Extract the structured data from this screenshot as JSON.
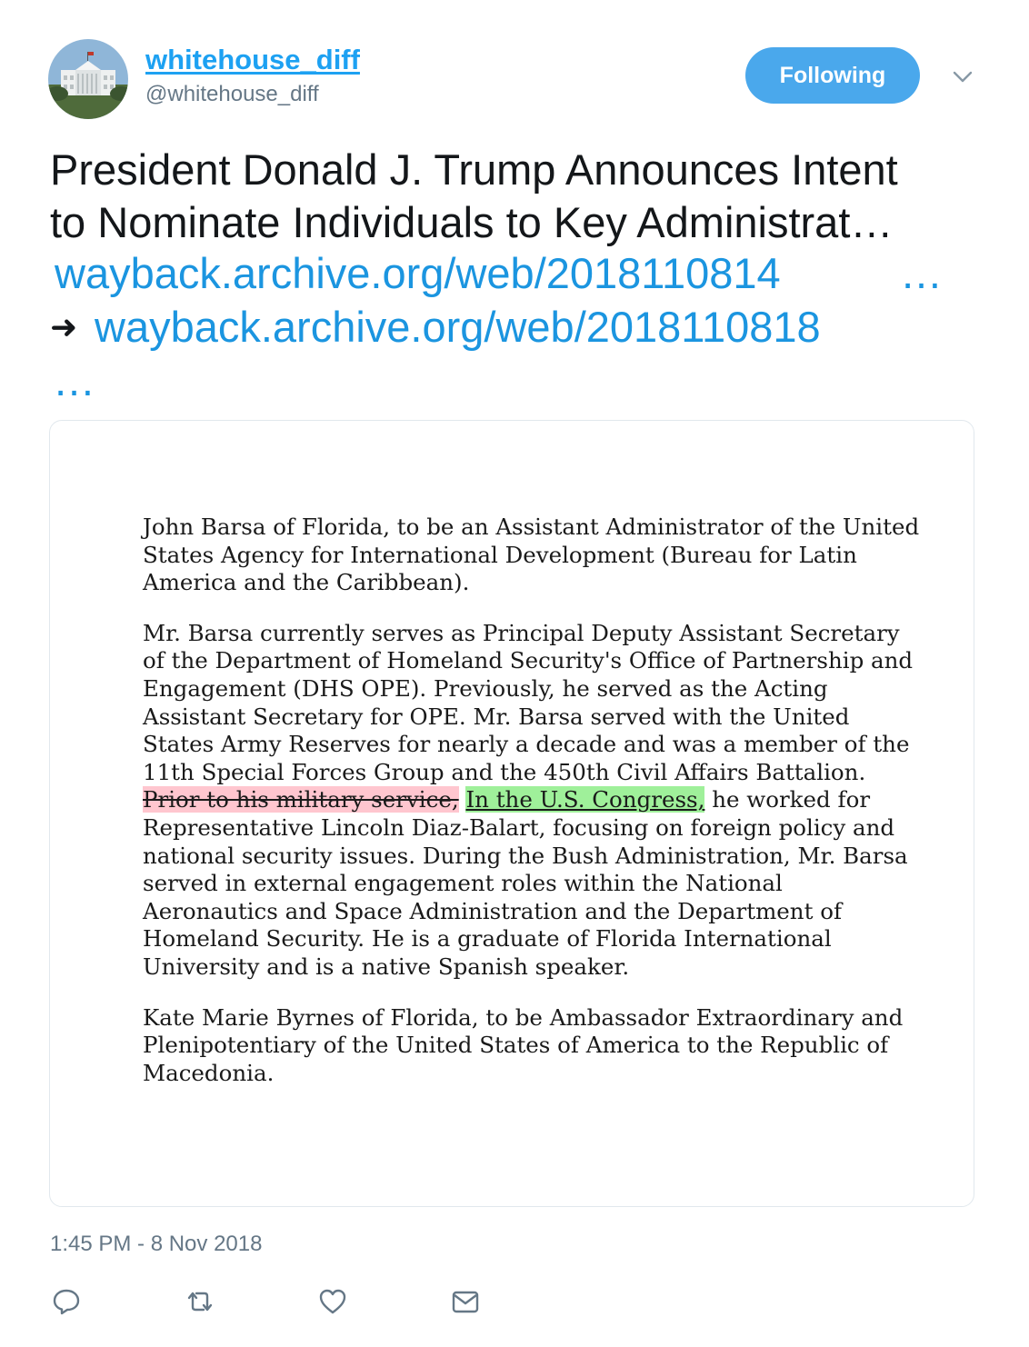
{
  "author": {
    "name": "whitehouse_diff",
    "handle": "@whitehouse_diff",
    "avatar_icon": "white-house-photo"
  },
  "follow_button": {
    "label": "Following",
    "color": "#4aa8ec"
  },
  "tweet": {
    "headline_line1": "President Donald J. Trump Announces Intent",
    "headline_line2": "to Nominate Individuals to Key Administrat…",
    "link1": "wayback.archive.org/web/2018110814",
    "link1_ellipsis": "…",
    "arrow": "➜",
    "link2": "wayback.archive.org/web/2018110818",
    "link2_ellipsis": "…",
    "link_color": "#1b95e0"
  },
  "document": {
    "para1": "John Barsa of Florida, to be an Assistant Administrator of the United States Agency for International Development (Bureau for Latin America and the Caribbean).",
    "para2_before": "Mr. Barsa currently serves as Principal Deputy Assistant Secretary of the Department of Homeland Security's Office of Partnership and Engagement (DHS OPE). Previously, he served as the Acting Assistant Secretary for OPE. Mr. Barsa served with the United States Army Reserves for nearly a decade and was a member of the 11th Special Forces Group and the 450th Civil Affairs Battalion.",
    "para2_deleted": "Prior to his military service,",
    "para2_inserted": "In the U.S. Congress,",
    "para2_after": "he worked for Representative Lincoln Diaz-Balart, focusing on foreign policy and national security issues. During the Bush Administration, Mr. Barsa served in external engagement roles within the National Aeronautics and Space Administration and the Department of Homeland Security. He is a graduate of Florida International University and is a native Spanish speaker.",
    "para3": "Kate Marie Byrnes of Florida, to be Ambassador Extraordinary and Plenipotentiary of the United States of America to the Republic of Macedonia.",
    "deleted_color": "#ffc6cf",
    "inserted_color": "#9ff09a"
  },
  "timestamp": "1:45 PM - 8 Nov 2018",
  "actions": [
    "reply-icon",
    "retweet-icon",
    "like-icon",
    "message-icon"
  ]
}
